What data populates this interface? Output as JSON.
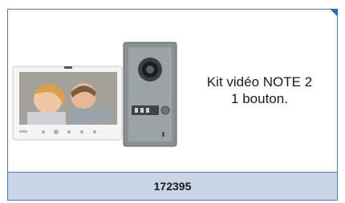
{
  "product": {
    "line1": "Kit vidéo NOTE 2",
    "line2": "1 bouton."
  },
  "footer": {
    "reference": "172395"
  }
}
